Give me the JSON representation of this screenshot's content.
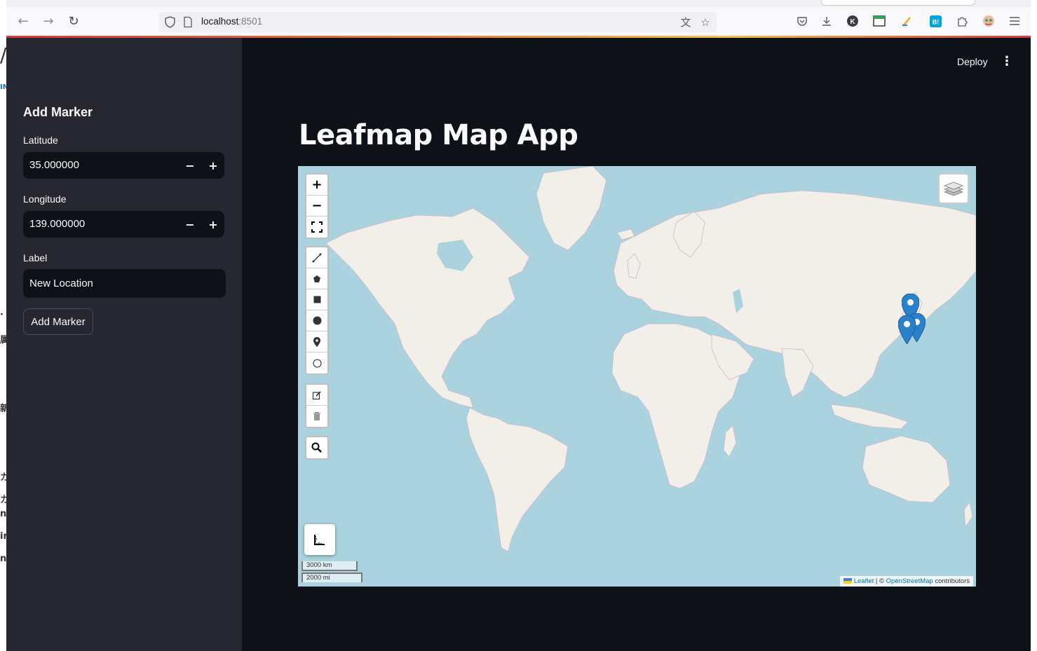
{
  "browser": {
    "url_host": "localhost",
    "url_port": ":8501"
  },
  "background_page": {
    "glyphs": [
      "/",
      "IN",
      "·",
      "属",
      "新",
      "カ",
      "カ",
      "na",
      "in",
      "n"
    ]
  },
  "sidebar": {
    "heading": "Add Marker",
    "latitude": {
      "label": "Latitude",
      "value": "35.000000",
      "minus": "−",
      "plus": "+"
    },
    "longitude": {
      "label": "Longitude",
      "value": "139.000000",
      "minus": "−",
      "plus": "+"
    },
    "label_field": {
      "label": "Label",
      "value": "New Location"
    },
    "add_button": "Add Marker"
  },
  "header": {
    "deploy_label": "Deploy",
    "menu_icon": "kebab-menu-icon"
  },
  "main": {
    "title": "Leafmap Map App"
  },
  "map": {
    "center": {
      "lat": 20,
      "lon": 10
    },
    "zoom_controls": {
      "zoom_in": "+",
      "zoom_out": "−"
    },
    "draw_tools": [
      "polyline-icon",
      "polygon-icon",
      "rectangle-icon",
      "circle-icon",
      "marker-icon",
      "circlemarker-icon"
    ],
    "edit_tools": [
      "edit-icon",
      "trash-icon"
    ],
    "scale": {
      "metric": "3000 km",
      "imperial": "2000 mi"
    },
    "attribution": {
      "leaflet": "Leaflet",
      "separator": "| ©",
      "osm": "OpenStreetMap",
      "suffix": "contributors"
    },
    "markers": [
      {
        "lat": 38.5,
        "lon": 139.5
      },
      {
        "lat": 35.7,
        "lon": 139.7
      },
      {
        "lat": 35.0,
        "lon": 139.0
      }
    ],
    "colors": {
      "water": "#aad3df",
      "land": "#f2efe9",
      "marker": "#2a81cb"
    }
  }
}
